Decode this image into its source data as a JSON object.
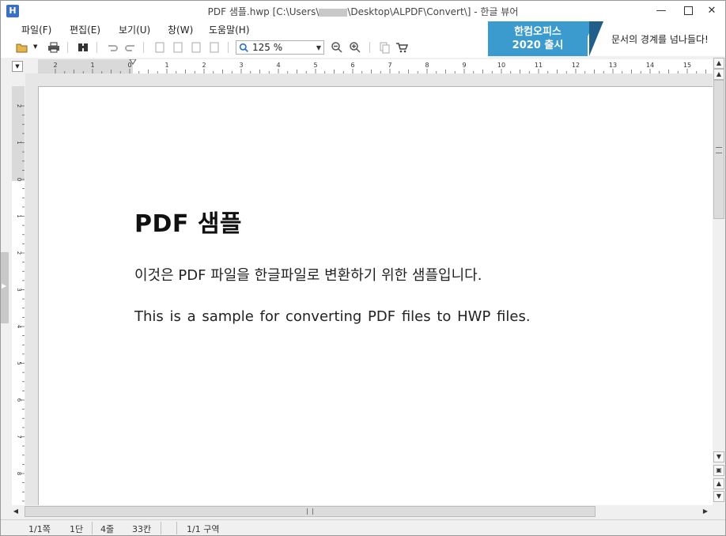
{
  "window": {
    "title_prefix": "PDF 샘플.hwp [C:\\Users\\",
    "title_suffix": "\\Desktop\\ALPDF\\Convert\\] - 한글 뷰어",
    "app_icon": "hwp-icon"
  },
  "menu": [
    "파일(F)",
    "편집(E)",
    "보기(U)",
    "창(W)",
    "도움말(H)"
  ],
  "ad": {
    "line1": "한컴오피스",
    "line2": "2020 출시",
    "slogan": "문서의 경계를 넘나들다!"
  },
  "toolbar": {
    "zoom": "125 %",
    "icons": [
      "open-folder-icon",
      "print-icon",
      "find-icon",
      "undo-icon",
      "redo-icon",
      "page-first-icon",
      "page-prev-icon",
      "page-next-icon",
      "page-last-icon",
      "zoom-out-icon",
      "zoom-in-icon",
      "copy-icon",
      "cart-icon"
    ]
  },
  "ruler": {
    "h_ticks": [
      "2",
      "1",
      "0",
      "1",
      "2",
      "3",
      "4",
      "5",
      "6",
      "7",
      "8",
      "9",
      "10",
      "11",
      "12",
      "13",
      "14",
      "15"
    ],
    "v_ticks": [
      "2",
      "1",
      "0",
      "1",
      "2",
      "3",
      "4",
      "5",
      "6",
      "7",
      "8"
    ]
  },
  "document": {
    "title": "PDF 샘플",
    "paragraph1": "이것은 PDF 파일을 한글파일로 변환하기 위한 샘플입니다.",
    "paragraph2": "This is a sample for converting PDF files to HWP files."
  },
  "status": {
    "page": "1/1쪽",
    "column": "1단",
    "line": "4줄",
    "col_pos": "33칸",
    "section": "1/1 구역"
  },
  "colors": {
    "accent": "#3b9bcf",
    "accent_dark": "#1f5f8a",
    "app_icon": "#3b6fc2"
  }
}
